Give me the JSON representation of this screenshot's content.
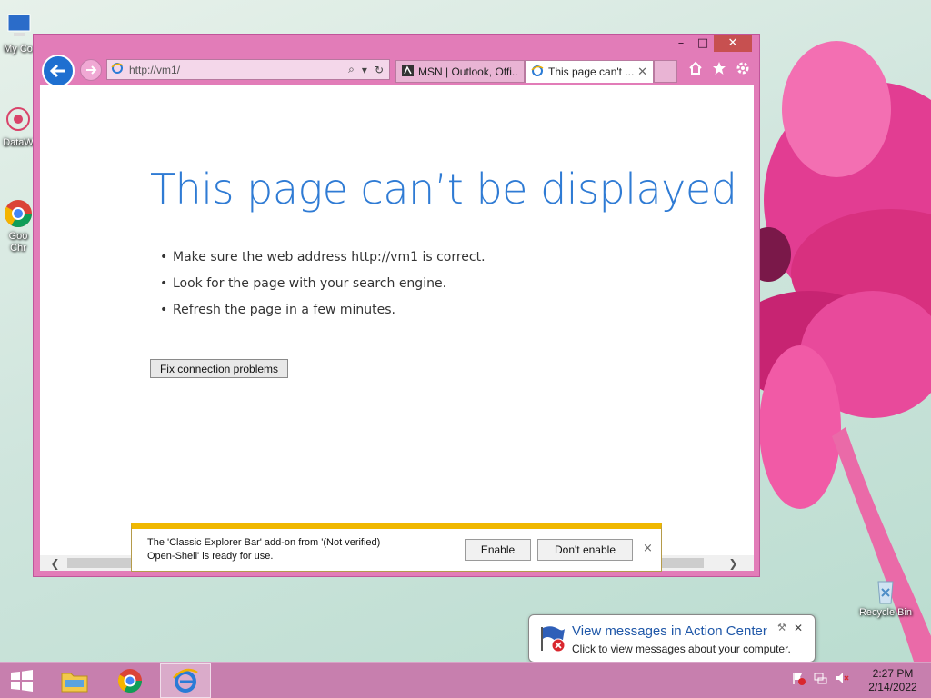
{
  "desktop": {
    "icons": [
      {
        "label": "My Co",
        "icon": "computer-icon"
      },
      {
        "label": "DataW",
        "icon": "datawrapper-icon"
      },
      {
        "label": "Goo",
        "label2": "Chr",
        "icon": "chrome-icon"
      },
      {
        "label": "Recycle Bin",
        "icon": "recycle-bin-icon"
      }
    ]
  },
  "browser": {
    "address": "http://vm1/",
    "tabs": [
      {
        "label": "MSN | Outlook, Offi...",
        "icon": "msn-icon"
      },
      {
        "label": "This page can't ...",
        "icon": "ie-icon"
      }
    ],
    "window_controls": {
      "minimize": "–",
      "maximize": "□",
      "close": "✕"
    }
  },
  "page": {
    "title": "This page can’t be displayed",
    "bullets": [
      "Make sure the web address http://vm1 is correct.",
      "Look for the page with your search engine.",
      "Refresh the page in a few minutes."
    ],
    "fix_button": "Fix connection problems"
  },
  "notification": {
    "line1": "The 'Classic Explorer Bar' add-on from '(Not verified)",
    "line2": "Open-Shell' is ready for use.",
    "enable_button": "Enable",
    "dont_enable_button": "Don't enable",
    "close": "×"
  },
  "balloon": {
    "title": "View messages in Action Center",
    "body": "Click to view messages about your computer.",
    "close": "✕"
  },
  "taskbar": {
    "time": "2:27 PM",
    "date": "2/14/2022"
  },
  "colors": {
    "window_frame": "#e27cb8",
    "title_blue": "#2f7bd4",
    "notification_accent": "#f0b800",
    "taskbar": "#c77fae"
  }
}
